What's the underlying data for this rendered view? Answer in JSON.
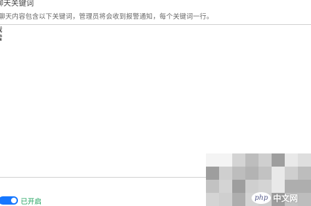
{
  "section": {
    "title": "聊天关键词",
    "description": "聊天内容包含以下关键词，管理员将会收到报警通知，每个关键词一行。"
  },
  "keywords_textarea": {
    "lines": [
      "戏",
      "雲"
    ]
  },
  "toggle": {
    "state_label": "已开启",
    "on": true,
    "accent_color": "#1677ff",
    "label_color": "#1aa05a"
  },
  "watermark": {
    "badge": "php",
    "text": "中文网"
  }
}
